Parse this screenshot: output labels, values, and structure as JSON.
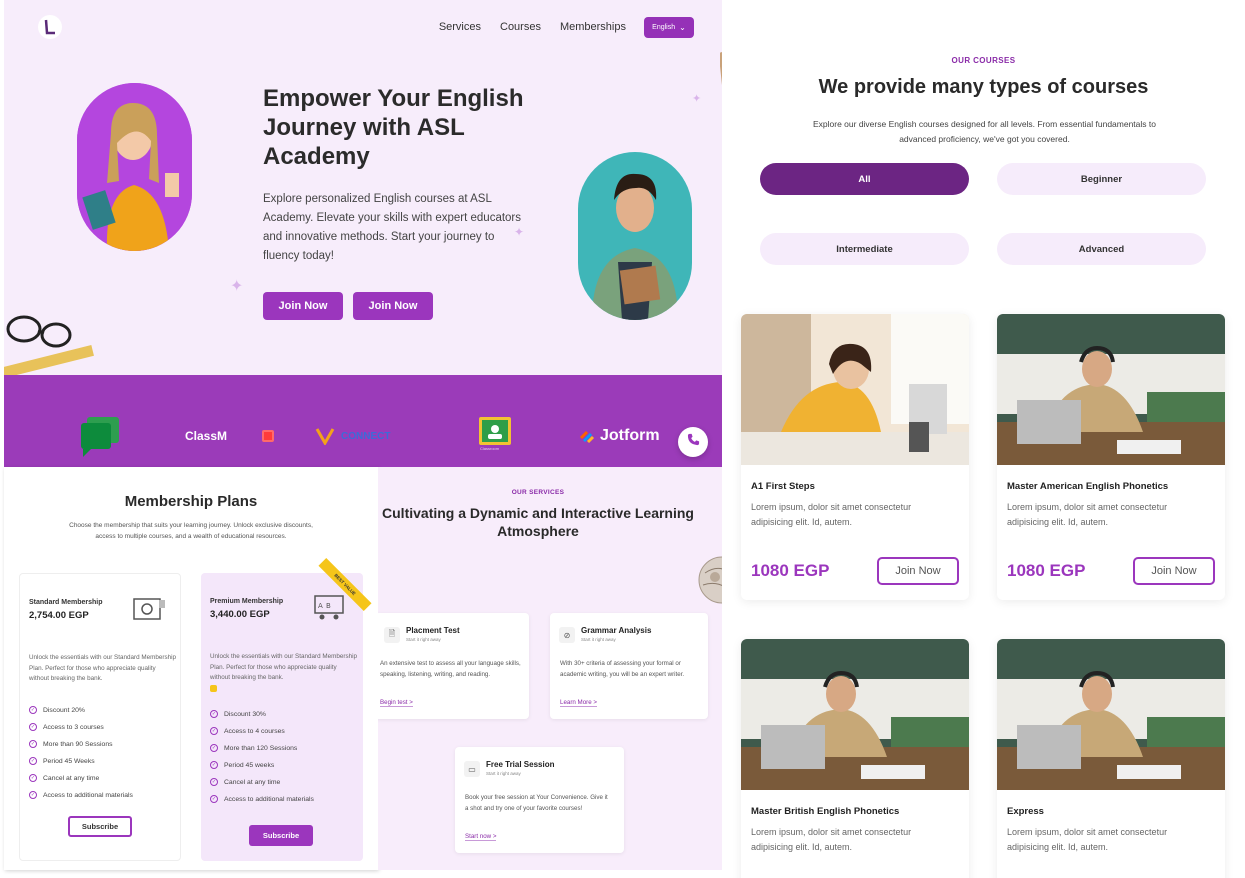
{
  "nav": {
    "items": [
      "Services",
      "Courses",
      "Memberships"
    ],
    "language": "English"
  },
  "hero": {
    "title": "Empower Your English Journey with ASL Academy",
    "description": "Explore personalized English courses at ASL Academy. Elevate your skills with expert educators and innovative methods. Start your journey to fluency today!",
    "buttons": [
      "Join Now",
      "Join Now"
    ]
  },
  "partners": {
    "classm": "ClassM",
    "connect": "CONNECT",
    "jotform": "Jotform",
    "classroom": "Classroom"
  },
  "memberships": {
    "title": "Membership Plans",
    "description": "Choose the membership that suits your learning journey. Unlock exclusive discounts, access to multiple courses, and a wealth of educational resources.",
    "plans": [
      {
        "name": "Standard Membership",
        "price": "2,754.00 EGP",
        "description": "Unlock the essentials with our Standard Membership Plan. Perfect for those who appreciate quality without breaking the bank.",
        "features": [
          "Discount 20%",
          "Access to 3 courses",
          "More than 90 Sessions",
          "Period 45 Weeks",
          "Cancel at any time",
          "Access to additional materials"
        ],
        "button": "Subscribe"
      },
      {
        "name": "Premium Membership",
        "price": "3,440.00 EGP",
        "badge": "BEST VALUE",
        "description": "Unlock the essentials with our Standard Membership Plan. Perfect for those who appreciate quality without breaking the bank.",
        "features": [
          "Discount 30%",
          "Access to 4 courses",
          "More than 120 Sessions",
          "Period 45 weeks",
          "Cancel at any time",
          "Access to additional materials"
        ],
        "button": "Subscribe"
      }
    ]
  },
  "services": {
    "eyebrow": "OUR SERVICES",
    "title": "Cultivating a Dynamic and Interactive Learning Atmosphere",
    "cards": [
      {
        "name": "Placment Test",
        "subtitle": "Start it right away",
        "description": "An extensive test to assess all your language skills, speaking, listening, writing, and reading.",
        "link": "Begin test >"
      },
      {
        "name": "Grammar Analysis",
        "subtitle": "Start it right away",
        "description": "With 30+ criteria of assessing your formal or academic writing, you will be an expert writer.",
        "link": "Learn More >"
      },
      {
        "name": "Free Trial Session",
        "subtitle": "Start it right away",
        "description": "Book your free session at Your Convenience. Give it a shot and try one of your favorite courses!",
        "link": "Start now >"
      }
    ]
  },
  "courses": {
    "eyebrow": "OUR COURSES",
    "title": "We provide many types of courses",
    "description": "Explore our diverse English courses designed for all levels. From essential fundamentals to advanced proficiency, we've got you covered.",
    "filters": [
      "All",
      "Beginner",
      "Intermediate",
      "Advanced"
    ],
    "active_filter": "All",
    "cards": [
      {
        "title": "A1 First Steps",
        "description": "Lorem ipsum, dolor sit amet consectetur adipisicing elit. Id, autem.",
        "price": "1080 EGP",
        "button": "Join Now"
      },
      {
        "title": "Master American English Phonetics",
        "description": "Lorem ipsum, dolor sit amet consectetur adipisicing elit. Id, autem.",
        "price": "1080 EGP",
        "button": "Join Now"
      },
      {
        "title": "Master British English Phonetics",
        "description": "Lorem ipsum, dolor sit amet consectetur adipisicing elit. Id, autem."
      },
      {
        "title": "Express",
        "description": "Lorem ipsum, dolor sit amet consectetur adipisicing elit. Id, autem."
      }
    ]
  },
  "colors": {
    "primary": "#9b36bd",
    "dark_primary": "#6c2583",
    "hero_bg": "#f7edfb",
    "strip_bg": "#9b3bb9",
    "badge": "#f5c51a"
  }
}
